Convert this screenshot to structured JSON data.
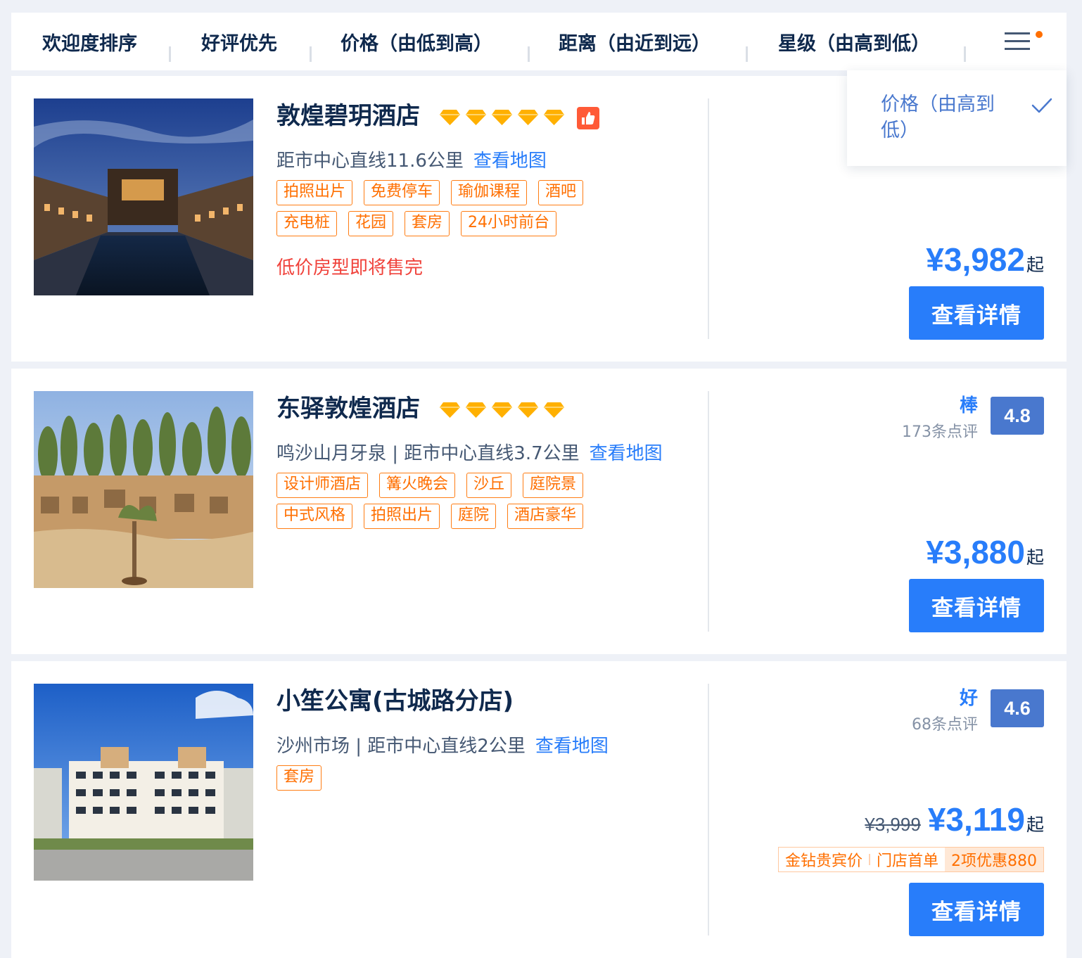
{
  "sort_bar": {
    "items": [
      {
        "label": "欢迎度排序"
      },
      {
        "label": "好评优先"
      },
      {
        "label": "价格（由低到高）"
      },
      {
        "label": "距离（由近到远）"
      },
      {
        "label": "星级（由高到低）"
      }
    ],
    "menu_icon": "hamburger-menu-icon",
    "notification_dot_color": "#ff6f00"
  },
  "dropdown": {
    "selected_label": "价格（由高到低）",
    "check_icon": "check-icon"
  },
  "hotels": [
    {
      "name": "敦煌碧玥酒店",
      "diamond_count": 5,
      "badge_icon": "thumbs-up-icon",
      "distance": "距市中心直线11.6公里",
      "map_link": "查看地图",
      "tags": [
        "拍照出片",
        "免费停车",
        "瑜伽课程",
        "酒吧",
        "充电桩",
        "花园",
        "套房",
        "24小时前台"
      ],
      "notice": "低价房型即将售完",
      "price": "¥3,982",
      "price_suffix": "起",
      "button": "查看详情"
    },
    {
      "name": "东驿敦煌酒店",
      "diamond_count": 5,
      "distance": "鸣沙山月牙泉 | 距市中心直线3.7公里",
      "map_link": "查看地图",
      "rating_word": "棒",
      "review_count": "173条点评",
      "score": "4.8",
      "tags": [
        "设计师酒店",
        "篝火晚会",
        "沙丘",
        "庭院景",
        "中式风格",
        "拍照出片",
        "庭院",
        "酒店豪华"
      ],
      "price": "¥3,880",
      "price_suffix": "起",
      "button": "查看详情"
    },
    {
      "name": "小笙公寓(古城路分店)",
      "distance": "沙州市场 | 距市中心直线2公里",
      "map_link": "查看地图",
      "rating_word": "好",
      "review_count": "68条点评",
      "score": "4.6",
      "tags": [
        "套房"
      ],
      "original_price": "¥3,999",
      "price": "¥3,119",
      "price_suffix": "起",
      "promo": [
        "金钻贵宾价",
        "门店首单",
        "2项优惠880"
      ],
      "button": "查看详情"
    }
  ],
  "colors": {
    "accent_blue": "#287dfa",
    "score_blue": "#4978ce",
    "tag_orange": "#ff6f00",
    "warning_red": "#f0433c",
    "diamond_gold": "#ffb000"
  }
}
